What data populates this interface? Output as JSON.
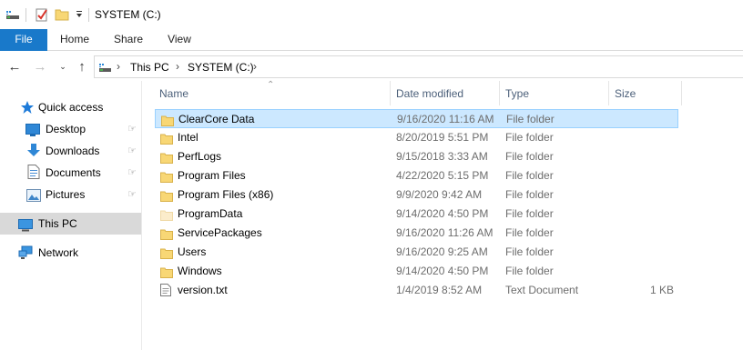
{
  "window": {
    "title": "SYSTEM (C:)"
  },
  "ribbon": {
    "tabs": [
      "File",
      "Home",
      "Share",
      "View"
    ]
  },
  "address": {
    "crumbs": [
      "This PC",
      "SYSTEM (C:)"
    ]
  },
  "navpane": {
    "quick_access": "Quick access",
    "pinned": [
      "Desktop",
      "Downloads",
      "Documents",
      "Pictures"
    ],
    "this_pc": "This PC",
    "network": "Network"
  },
  "columns": {
    "name": "Name",
    "date": "Date modified",
    "type": "Type",
    "size": "Size"
  },
  "files": [
    {
      "name": "ClearCore Data",
      "date": "9/16/2020 11:16 AM",
      "type": "File folder",
      "size": "",
      "icon": "folder-icon"
    },
    {
      "name": "Intel",
      "date": "8/20/2019 5:51 PM",
      "type": "File folder",
      "size": "",
      "icon": "folder-icon"
    },
    {
      "name": "PerfLogs",
      "date": "9/15/2018 3:33 AM",
      "type": "File folder",
      "size": "",
      "icon": "folder-icon"
    },
    {
      "name": "Program Files",
      "date": "4/22/2020 5:15 PM",
      "type": "File folder",
      "size": "",
      "icon": "folder-icon"
    },
    {
      "name": "Program Files (x86)",
      "date": "9/9/2020 9:42 AM",
      "type": "File folder",
      "size": "",
      "icon": "folder-icon"
    },
    {
      "name": "ProgramData",
      "date": "9/14/2020 4:50 PM",
      "type": "File folder",
      "size": "",
      "icon": "hidden-folder-icon"
    },
    {
      "name": "ServicePackages",
      "date": "9/16/2020 11:26 AM",
      "type": "File folder",
      "size": "",
      "icon": "folder-icon"
    },
    {
      "name": "Users",
      "date": "9/16/2020 9:25 AM",
      "type": "File folder",
      "size": "",
      "icon": "folder-icon"
    },
    {
      "name": "Windows",
      "date": "9/14/2020 4:50 PM",
      "type": "File folder",
      "size": "",
      "icon": "folder-icon"
    },
    {
      "name": "version.txt",
      "date": "1/4/2019 8:52 AM",
      "type": "Text Document",
      "size": "1 KB",
      "icon": "text-file-icon"
    }
  ],
  "colors": {
    "accent": "#1979ca",
    "selection_fill": "#cce8ff",
    "selection_border": "#99d1ff",
    "folder": "#f8d775",
    "nav_selected": "#d9d9d9"
  }
}
